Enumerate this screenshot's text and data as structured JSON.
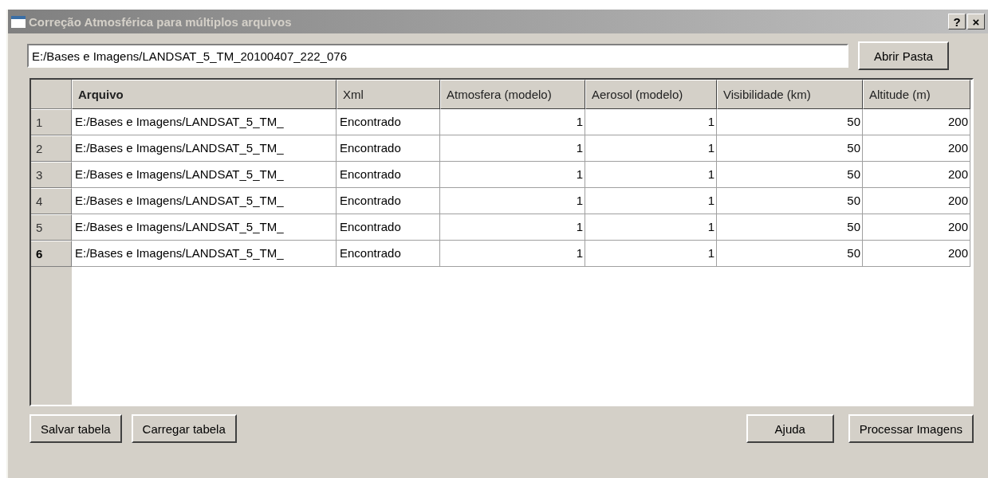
{
  "window": {
    "title": "Correção Atmosférica para múltiplos arquivos",
    "active": false,
    "controls": [
      "?",
      "×"
    ]
  },
  "path_field": {
    "value": "E:/Bases e Imagens/LANDSAT_5_TM_20100407_222_076"
  },
  "open_button": "Abrir Pasta",
  "table": {
    "columns": [
      {
        "label": "Arquivo",
        "kind": "text",
        "bold": true
      },
      {
        "label": "Xml",
        "kind": "text",
        "bold": false
      },
      {
        "label": "Atmosfera (modelo)",
        "kind": "number",
        "bold": false
      },
      {
        "label": "Aerosol (modelo)",
        "kind": "number",
        "bold": false
      },
      {
        "label": "Visibilidade (km)",
        "kind": "number",
        "bold": false
      },
      {
        "label": "Altitude (m)",
        "kind": "number",
        "bold": false
      }
    ],
    "rows": [
      {
        "number": "1",
        "current": false,
        "cells": [
          "E:/Bases e Imagens/LANDSAT_5_TM_",
          "Encontrado",
          "1",
          "1",
          "50",
          "200"
        ]
      },
      {
        "number": "2",
        "current": false,
        "cells": [
          "E:/Bases e Imagens/LANDSAT_5_TM_",
          "Encontrado",
          "1",
          "1",
          "50",
          "200"
        ]
      },
      {
        "number": "3",
        "current": false,
        "cells": [
          "E:/Bases e Imagens/LANDSAT_5_TM_",
          "Encontrado",
          "1",
          "1",
          "50",
          "200"
        ]
      },
      {
        "number": "4",
        "current": false,
        "cells": [
          "E:/Bases e Imagens/LANDSAT_5_TM_",
          "Encontrado",
          "1",
          "1",
          "50",
          "200"
        ]
      },
      {
        "number": "5",
        "current": false,
        "cells": [
          "E:/Bases e Imagens/LANDSAT_5_TM_",
          "Encontrado",
          "1",
          "1",
          "50",
          "200"
        ]
      },
      {
        "number": "6",
        "current": true,
        "cells": [
          "E:/Bases e Imagens/LANDSAT_5_TM_",
          "Encontrado",
          "1",
          "1",
          "50",
          "200"
        ]
      }
    ]
  },
  "left_buttons": [
    "Salvar tabela",
    "Carregar tabela"
  ],
  "right_buttons": [
    "Ajuda",
    "Processar Imagens"
  ]
}
